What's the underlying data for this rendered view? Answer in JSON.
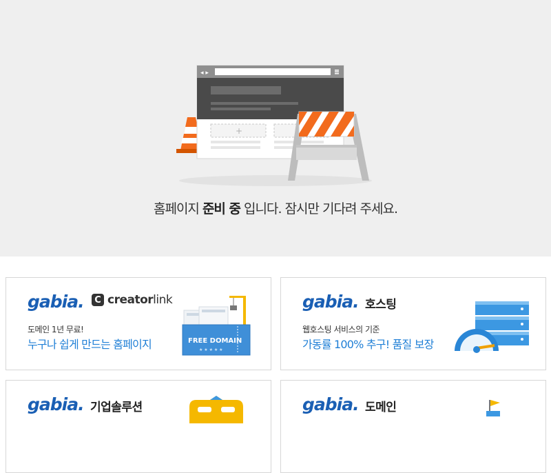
{
  "hero": {
    "message_prefix": "홈페이지 ",
    "message_bold": "준비 중",
    "message_suffix": " 입니다. 잠시만 기다려 주세요."
  },
  "cards": {
    "creatorlink": {
      "logo": "gabia.",
      "brand_bold": "creator",
      "brand_light": "link",
      "tagline": "도메인 1년 무료!",
      "headline": "누구나 쉽게 만드는 홈페이지",
      "ticket_text": "FREE DOMAIN"
    },
    "hosting": {
      "logo": "gabia.",
      "service": "호스팅",
      "tagline": "웹호스팅 서비스의 기준",
      "headline": "가동률 100% 추구! 품질 보장"
    },
    "enterprise": {
      "logo": "gabia.",
      "service": "기업솔루션"
    },
    "domain": {
      "logo": "gabia.",
      "service": "도메인"
    }
  },
  "colors": {
    "hero_bg": "#efefef",
    "brand_blue": "#1a5fb4",
    "headline_blue": "#1f7fd6",
    "cone_orange": "#f26b1d"
  }
}
